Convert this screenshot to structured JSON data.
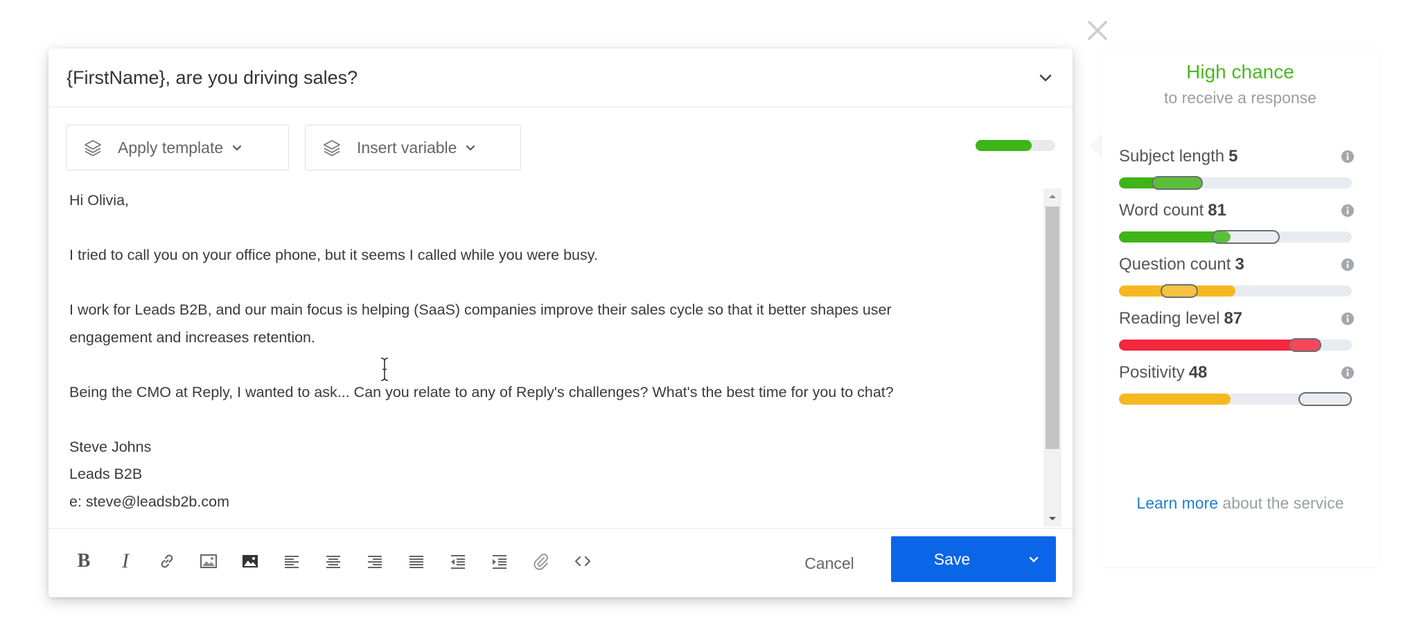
{
  "editor": {
    "subject": "{FirstName}, are you driving sales?",
    "apply_template_label": "Apply template",
    "insert_variable_label": "Insert variable",
    "score_fraction": 0.7,
    "score_color": "#3fb418",
    "body_lines": [
      "Hi Olivia,",
      "",
      "I tried to call you on your office phone, but it seems I called while you were busy.",
      "",
      "I work for Leads B2B, and our main focus is helping (SaaS) companies improve their sales cycle so that it better shapes user",
      "engagement and increases retention.",
      "",
      "Being the CMO at Reply, I wanted to ask... Can you relate to any of Reply's challenges? What's the best time for you to chat?",
      "",
      "Steve Johns",
      "Leads B2B",
      "e: steve@leadsb2b.com"
    ],
    "format_icons": [
      "bold-icon",
      "italic-icon",
      "link-icon",
      "image-icon",
      "image-filled-icon",
      "align-left-icon",
      "align-center-icon",
      "align-right-icon",
      "align-justify-icon",
      "outdent-icon",
      "indent-icon",
      "attachment-icon",
      "code-icon"
    ],
    "cancel_label": "Cancel",
    "save_label": "Save",
    "accent_color": "#0a66e6"
  },
  "panel": {
    "chance_title": "High chance",
    "chance_subtitle": "to receive a response",
    "metrics": [
      {
        "label": "Subject length",
        "value": "5",
        "fill": 0.36,
        "color": "#3fb418",
        "target_start": 0.14,
        "target_end": 0.36
      },
      {
        "label": "Word count",
        "value": "81",
        "fill": 0.48,
        "color": "#3fb418",
        "target_start": 0.4,
        "target_end": 0.69
      },
      {
        "label": "Question count",
        "value": "3",
        "fill": 0.5,
        "color": "#f5b820",
        "target_start": 0.18,
        "target_end": 0.34
      },
      {
        "label": "Reading level",
        "value": "87",
        "fill": 0.87,
        "color": "#f2283f",
        "target_start": 0.73,
        "target_end": 0.87
      },
      {
        "label": "Positivity",
        "value": "48",
        "fill": 0.48,
        "color": "#f5b820",
        "target_start": 0.77,
        "target_end": 1.0
      }
    ],
    "learn_more_link": "Learn more",
    "learn_more_rest": " about the service"
  }
}
